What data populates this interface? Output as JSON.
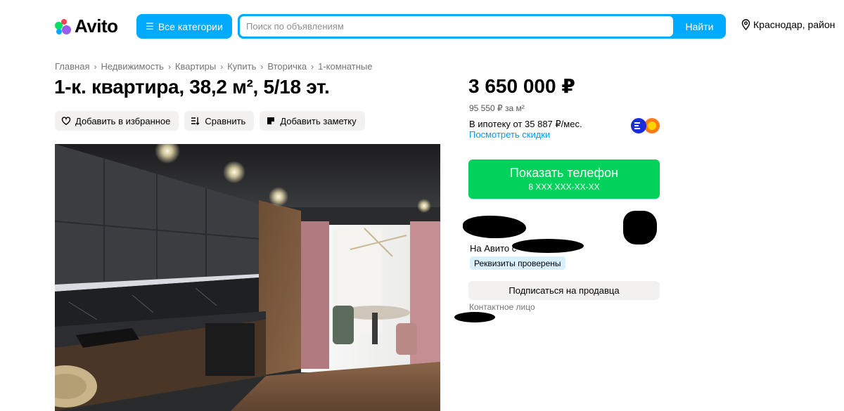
{
  "header": {
    "logo_text": "Avito",
    "categories_label": "Все категории",
    "search_placeholder": "Поиск по объявлениям",
    "search_button": "Найти",
    "location": "Краснодар, район"
  },
  "breadcrumbs": [
    "Главная",
    "Недвижимость",
    "Квартиры",
    "Купить",
    "Вторичка",
    "1-комнатные"
  ],
  "listing": {
    "title": "1-к. квартира, 38,2 м², 5/18 эт.",
    "actions": {
      "favorite": "Добавить в избранное",
      "compare": "Сравнить",
      "note": "Добавить заметку"
    }
  },
  "sidebar": {
    "price": "3 650 000 ₽",
    "price_per_m": "95 550 ₽ за м²",
    "mortgage": "В ипотеку от 35 887 ₽/мес.",
    "discount_link": "Посмотреть скидки",
    "phone_button": "Показать телефон",
    "phone_masked": "8 XXX XXX-XX-XX",
    "on_avito_prefix": "На Авито с",
    "verified_badge": "Реквизиты проверены",
    "subscribe_button": "Подписаться на продавца",
    "contact_label": "Контактное лицо"
  },
  "colors": {
    "accent": "#00aaff",
    "phone_green": "#02d15c",
    "link": "#0099f7"
  }
}
